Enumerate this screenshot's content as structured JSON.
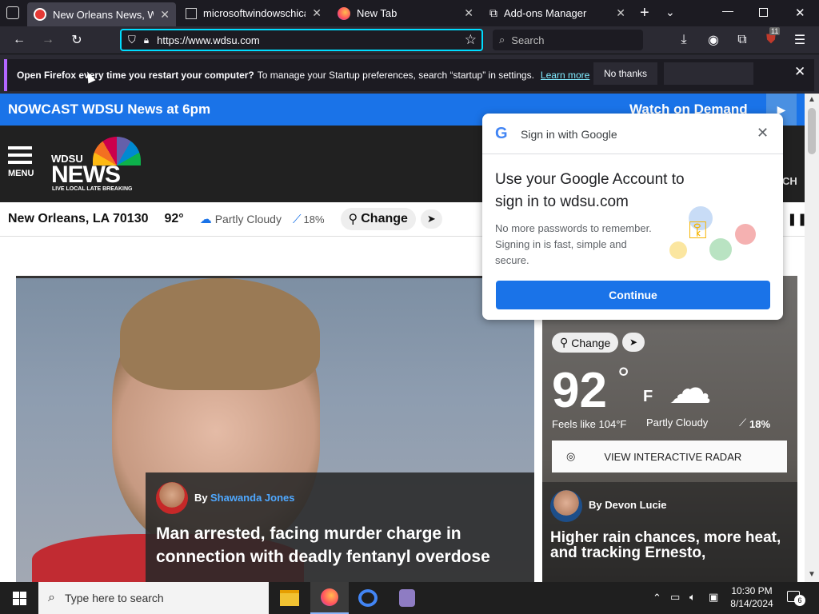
{
  "tabs": [
    {
      "title": "New Orleans News, Weat",
      "active": true
    },
    {
      "title": "microsoftwindowschicag",
      "active": false
    },
    {
      "title": "New Tab",
      "active": false
    },
    {
      "title": "Add-ons Manager",
      "active": false
    }
  ],
  "nav": {
    "url": "https://www.wdsu.com",
    "search_placeholder": "Search",
    "extension_badge": "11"
  },
  "notification": {
    "bold": "Open Firefox every time you restart your computer?",
    "text": "To manage your Startup preferences, search “startup” in settings.",
    "link": "Learn more",
    "no_thanks": "No thanks"
  },
  "site": {
    "nowcast": "NOWCAST WDSU News at 6pm",
    "watch": "Watch on Demand",
    "menu": "MENU",
    "logo_top": "WDSU",
    "logo_main": "NEWS",
    "logo_tag": "LIVE LOCAL LATE BREAKING",
    "header_right": "CH"
  },
  "weather_bar": {
    "location": "New Orleans, LA 70130",
    "temp": "92°",
    "condition": "Partly Cloudy",
    "precip": "18%",
    "change": "Change"
  },
  "story": {
    "by": "By",
    "author": "Shawanda Jones",
    "headline": "Man arrested, facing murder charge in connection with deadly fentanyl overdose"
  },
  "weather_card": {
    "change": "Change",
    "temp": "92",
    "deg": "°",
    "unit": "F",
    "feels": "Feels like 104°F",
    "condition": "Partly Cloudy",
    "precip": "18%",
    "radar": "VIEW INTERACTIVE RADAR",
    "by": "By Devon Lucie",
    "headline": "Higher rain chances, more heat, and tracking Ernesto,"
  },
  "google": {
    "header": "Sign in with Google",
    "title": "Use your Google Account to sign in to wdsu.com",
    "body": "No more passwords to remember. Signing in is fast, simple and secure.",
    "continue": "Continue"
  },
  "taskbar": {
    "search": "Type here to search",
    "time": "10:30 PM",
    "date": "8/14/2024",
    "notif_count": "6"
  },
  "colors": {
    "accent": "#1a73e8",
    "firefox_focus": "#00ddff",
    "header": "#212121"
  }
}
